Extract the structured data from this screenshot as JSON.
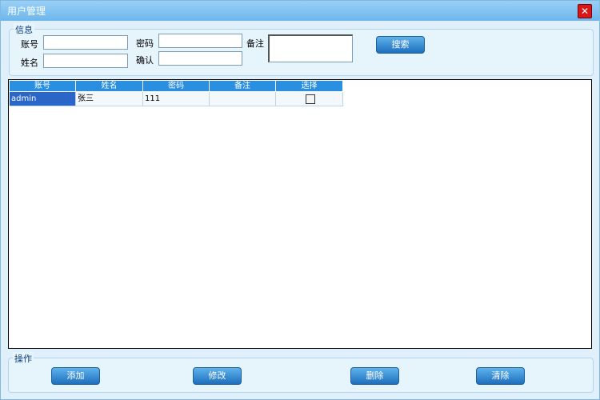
{
  "window": {
    "title": "用户管理",
    "close_symbol": "✕"
  },
  "info": {
    "group_title": "信息",
    "account_label": "账号",
    "name_label": "姓名",
    "password_label": "密码",
    "confirm_label": "确认",
    "remark_label": "备注",
    "account_value": "",
    "name_value": "",
    "password_value": "",
    "confirm_value": "",
    "remark_value": "",
    "search_label": "搜索"
  },
  "grid": {
    "columns": [
      "账号",
      "姓名",
      "密码",
      "备注",
      "选择"
    ],
    "rows": [
      {
        "account": "admin",
        "name": "张三",
        "password": "111",
        "remark": "",
        "selected": false
      }
    ]
  },
  "actions": {
    "group_title": "操作",
    "add_label": "添加",
    "edit_label": "修改",
    "delete_label": "删除",
    "clear_label": "清除"
  }
}
